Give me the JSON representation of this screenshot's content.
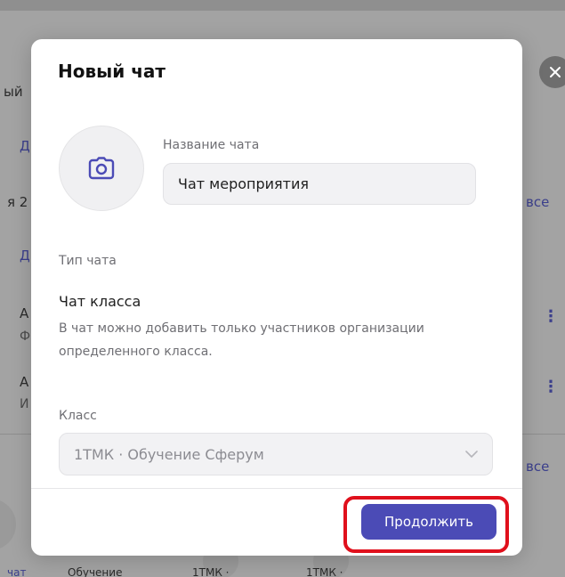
{
  "modal": {
    "title": "Новый чат",
    "chat_name_label": "Название чата",
    "chat_name_value": "Чат мероприятия",
    "chat_type_label": "Тип чата",
    "chat_type_title": "Чат класса",
    "chat_type_description": "В чат можно добавить только участников организации определенного класса.",
    "class_label": "Класс",
    "class_selected": "1ТМК · Обучение Сферум",
    "continue_label": "Продолжить"
  },
  "background": {
    "frag_1": "ый",
    "frag_2": "Д",
    "frag_3": "я 2",
    "frag_4": "Д",
    "frag_5": "А",
    "frag_6": "Ф",
    "frag_7": "А",
    "frag_8": "И",
    "see_all_1": "все",
    "see_all_2": "все",
    "bottom_1": "чат",
    "bottom_2": "Обучение",
    "bottom_3": "1ТМК ·",
    "bottom_4": "1ТМК ·"
  },
  "colors": {
    "accent": "#4b4bb6",
    "highlight": "#e0101c"
  }
}
